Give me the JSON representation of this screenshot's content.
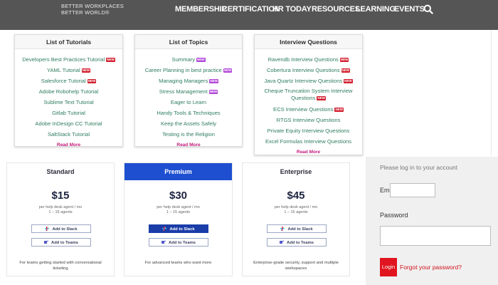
{
  "header": {
    "logo_line1": "BETTER WORKPLACES",
    "logo_line2": "BETTER WORLD",
    "logo_mark": "®",
    "nav": [
      "MEMBERSHIP",
      "CERTIFICATION",
      "HR TODAY",
      "RESOURCES",
      "LEARNING",
      "EVENTS"
    ],
    "icon": "search-icon"
  },
  "cards": [
    {
      "title": "List of Tutorials",
      "items": [
        {
          "label": "Developers Best Practices Tutorial",
          "badge": "NEW",
          "badge_color": "#d21e2d"
        },
        {
          "label": "YAML Tutorial",
          "badge": "NEW",
          "badge_color": "#d21e2d"
        },
        {
          "label": "Salesforce Tutorial",
          "badge": "NEW",
          "badge_color": "#d21e2d"
        },
        {
          "label": "Adobe Robohelp Tutorial",
          "badge": "",
          "badge_color": ""
        },
        {
          "label": "Sublime Text Tutorial",
          "badge": "",
          "badge_color": ""
        },
        {
          "label": "Gitlab Tutorial",
          "badge": "",
          "badge_color": ""
        },
        {
          "label": "Adobe InDesign CC Tutorial",
          "badge": "",
          "badge_color": ""
        },
        {
          "label": "SaltStack Tutorial",
          "badge": "",
          "badge_color": ""
        }
      ],
      "read_more": "Read More"
    },
    {
      "title": "List of Topics",
      "items": [
        {
          "label": "Summary",
          "badge": "NEW",
          "badge_color": "#b147d9"
        },
        {
          "label": "Career Planning in best practice",
          "badge": "NEW",
          "badge_color": "#b147d9"
        },
        {
          "label": "Managing Managers",
          "badge": "NEW",
          "badge_color": "#b147d9"
        },
        {
          "label": "Stress Management",
          "badge": "NEW",
          "badge_color": "#b147d9"
        },
        {
          "label": "Eager to Learn",
          "badge": "",
          "badge_color": ""
        },
        {
          "label": "Handy Tools & Techniques",
          "badge": "",
          "badge_color": ""
        },
        {
          "label": "Keep the Assets Safely",
          "badge": "",
          "badge_color": ""
        },
        {
          "label": "Testing is the Religion",
          "badge": "",
          "badge_color": ""
        }
      ],
      "read_more": "Read More"
    },
    {
      "title": "Interview Questions",
      "items": [
        {
          "label": "Ravendb Interview Questions",
          "badge": "NEW",
          "badge_color": "#d21e2d"
        },
        {
          "label": "Cobertura Interview Questions",
          "badge": "NEW",
          "badge_color": "#d21e2d"
        },
        {
          "label": "Java Quartz Interview Questions",
          "badge": "NEW",
          "badge_color": "#d21e2d"
        },
        {
          "label": "Cheque Truncation System Interview Questions",
          "badge": "NEW",
          "badge_color": "#d21e2d"
        },
        {
          "label": "ECS Interview Questions",
          "badge": "NEW",
          "badge_color": "#d21e2d"
        },
        {
          "label": "RTGS Interview Questions",
          "badge": "",
          "badge_color": ""
        },
        {
          "label": "Private Equity Interview Questions",
          "badge": "",
          "badge_color": ""
        },
        {
          "label": "Excel Formulas Interview Questions",
          "badge": "",
          "badge_color": ""
        }
      ],
      "read_more": "Read More"
    }
  ],
  "pricing": [
    {
      "name": "Standard",
      "price": "$15",
      "note1": "per help desk agent / mo",
      "note2": "1 – 15 agents",
      "slack_label": "Add to Slack",
      "teams_label": "Add to Teams",
      "description": "For teams getting started with conversational ticketing",
      "accent": false
    },
    {
      "name": "Premium",
      "price": "$30",
      "note1": "per help desk agent / mo",
      "note2": "1 – 15 agents",
      "slack_label": "Add to Slack",
      "teams_label": "Add to Teams",
      "description": "For advanced teams who want more",
      "accent": true
    },
    {
      "name": "Enterprise",
      "price": "$45",
      "note1": "per help desk agent / mo",
      "note2": "1 – 15 agents",
      "slack_label": "Add to Slack",
      "teams_label": "Add to Teams",
      "description": "Enterprise-grade security, support and multiple workspaces",
      "accent": false
    }
  ],
  "login": {
    "prompt": "Please log in to your account",
    "email_label": "Email",
    "email_value": "",
    "password_label": "Password",
    "password_value": "",
    "login_button": "Login",
    "forgot_link": "Forgot your password?"
  },
  "colors": {
    "header_bg": "#555555",
    "link_green": "#2f7d5e",
    "read_more": "#c2187a",
    "badge_red": "#d21e2d",
    "badge_purple": "#b147d9",
    "premium_blue": "#1d4fd0",
    "login_red": "#e0151f"
  }
}
